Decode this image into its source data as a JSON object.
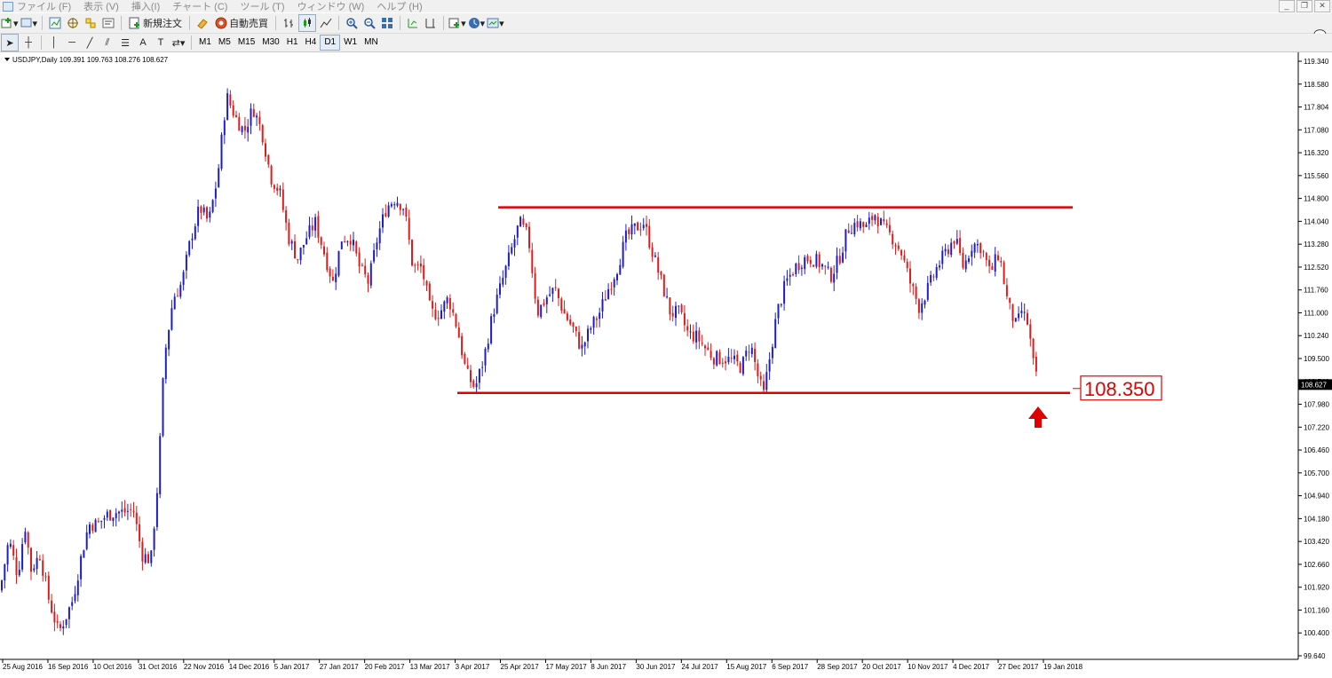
{
  "menu": {
    "items": [
      "ファイル (F)",
      "表示 (V)",
      "挿入(I)",
      "チャート (C)",
      "ツール (T)",
      "ウィンドウ (W)",
      "ヘルプ (H)"
    ]
  },
  "toolbar": {
    "new_order_label": "新規注文",
    "auto_trade_label": "自動売買",
    "timeframes": [
      "M1",
      "M5",
      "M15",
      "M30",
      "H1",
      "H4",
      "D1",
      "W1",
      "MN"
    ],
    "active_timeframe": "D1"
  },
  "chart_header": {
    "symbol_info": "USDJPY,Daily  109.391 109.763 108.276 108.627"
  },
  "colors": {
    "bull": "#1e1ec8",
    "bear": "#e01b1b",
    "level_line": "#e00000",
    "arrow": "#e00000"
  },
  "chart_data": {
    "type": "candlestick",
    "symbol": "USDJPY",
    "timeframe": "Daily",
    "ohlc_last": {
      "open": 109.391,
      "high": 109.763,
      "low": 108.276,
      "close": 108.627
    },
    "current_price_label": "108.627",
    "y_ticks": [
      "119.340",
      "118.580",
      "117.804",
      "117.080",
      "116.320",
      "115.560",
      "114.800",
      "114.040",
      "113.280",
      "112.520",
      "111.760",
      "111.000",
      "110.240",
      "109.500",
      "108.740",
      "107.980",
      "107.220",
      "106.460",
      "105.700",
      "104.940",
      "104.180",
      "103.420",
      "102.660",
      "101.920",
      "101.160",
      "100.400",
      "99.640"
    ],
    "x_ticks": [
      "25 Aug 2016",
      "16 Sep 2016",
      "10 Oct 2016",
      "31 Oct 2016",
      "22 Nov 2016",
      "14 Dec 2016",
      "5 Jan 2017",
      "27 Jan 2017",
      "20 Feb 2017",
      "13 Mar 2017",
      "3 Apr 2017",
      "25 Apr 2017",
      "17 May 2017",
      "8 Jun 2017",
      "30 Jun 2017",
      "24 Jul 2017",
      "15 Aug 2017",
      "6 Sep 2017",
      "28 Sep 2017",
      "20 Oct 2017",
      "10 Nov 2017",
      "4 Dec 2017",
      "27 Dec 2017",
      "19 Jan 2018"
    ],
    "ylim": [
      99.64,
      119.34
    ],
    "resistance_level": 114.5,
    "support_level": 108.35,
    "support_label": "108.350",
    "price_path": [
      [
        0,
        101.8
      ],
      [
        10,
        103.5
      ],
      [
        20,
        102.3
      ],
      [
        28,
        104.0
      ],
      [
        35,
        102.5
      ],
      [
        45,
        103.0
      ],
      [
        55,
        101.5
      ],
      [
        66,
        100.4
      ],
      [
        75,
        101.0
      ],
      [
        82,
        101.5
      ],
      [
        92,
        103.0
      ],
      [
        100,
        104.0
      ],
      [
        110,
        104.0
      ],
      [
        120,
        104.3
      ],
      [
        130,
        104.4
      ],
      [
        140,
        104.4
      ],
      [
        150,
        104.5
      ],
      [
        160,
        103.0
      ],
      [
        170,
        102.8
      ],
      [
        178,
        105.5
      ],
      [
        185,
        109.5
      ],
      [
        195,
        111.5
      ],
      [
        205,
        112.0
      ],
      [
        215,
        113.5
      ],
      [
        225,
        114.5
      ],
      [
        235,
        114.0
      ],
      [
        245,
        115.5
      ],
      [
        255,
        118.2
      ],
      [
        265,
        117.5
      ],
      [
        275,
        117.0
      ],
      [
        285,
        117.8
      ],
      [
        295,
        117.0
      ],
      [
        305,
        115.5
      ],
      [
        315,
        115.0
      ],
      [
        325,
        113.5
      ],
      [
        335,
        112.8
      ],
      [
        345,
        113.5
      ],
      [
        355,
        114.0
      ],
      [
        365,
        113.0
      ],
      [
        375,
        112.0
      ],
      [
        385,
        113.5
      ],
      [
        395,
        113.5
      ],
      [
        405,
        112.5
      ],
      [
        415,
        112.0
      ],
      [
        425,
        113.5
      ],
      [
        435,
        114.5
      ],
      [
        445,
        114.8
      ],
      [
        455,
        114.5
      ],
      [
        465,
        112.5
      ],
      [
        475,
        112.5
      ],
      [
        485,
        111.0
      ],
      [
        495,
        111.0
      ],
      [
        505,
        111.5
      ],
      [
        515,
        110.5
      ],
      [
        525,
        109.0
      ],
      [
        535,
        108.5
      ],
      [
        545,
        109.5
      ],
      [
        555,
        111.0
      ],
      [
        565,
        112.0
      ],
      [
        575,
        113.0
      ],
      [
        585,
        114.0
      ],
      [
        595,
        113.5
      ],
      [
        605,
        111.0
      ],
      [
        615,
        111.5
      ],
      [
        625,
        111.8
      ],
      [
        635,
        111.0
      ],
      [
        645,
        110.5
      ],
      [
        655,
        109.8
      ],
      [
        665,
        110.5
      ],
      [
        675,
        111.0
      ],
      [
        685,
        111.8
      ],
      [
        695,
        112.5
      ],
      [
        705,
        113.5
      ],
      [
        715,
        113.8
      ],
      [
        725,
        114.0
      ],
      [
        735,
        113.0
      ],
      [
        745,
        112.0
      ],
      [
        755,
        111.0
      ],
      [
        765,
        111.0
      ],
      [
        775,
        110.3
      ],
      [
        785,
        110.2
      ],
      [
        795,
        109.8
      ],
      [
        805,
        109.5
      ],
      [
        815,
        109.5
      ],
      [
        825,
        109.4
      ],
      [
        835,
        109.2
      ],
      [
        845,
        110.0
      ],
      [
        855,
        108.7
      ],
      [
        860,
        108.3
      ],
      [
        865,
        109.2
      ],
      [
        875,
        111.0
      ],
      [
        885,
        112.0
      ],
      [
        895,
        112.5
      ],
      [
        905,
        112.8
      ],
      [
        915,
        112.8
      ],
      [
        925,
        112.6
      ],
      [
        935,
        112.2
      ],
      [
        945,
        112.8
      ],
      [
        955,
        113.8
      ],
      [
        965,
        114.0
      ],
      [
        975,
        113.8
      ],
      [
        985,
        114.3
      ],
      [
        995,
        113.8
      ],
      [
        1005,
        113.5
      ],
      [
        1015,
        113.0
      ],
      [
        1025,
        112.0
      ],
      [
        1035,
        111.2
      ],
      [
        1045,
        111.8
      ],
      [
        1055,
        112.5
      ],
      [
        1065,
        113.0
      ],
      [
        1075,
        113.5
      ],
      [
        1085,
        112.5
      ],
      [
        1095,
        113.3
      ],
      [
        1105,
        113.2
      ],
      [
        1115,
        112.3
      ],
      [
        1125,
        113.0
      ],
      [
        1135,
        111.3
      ],
      [
        1145,
        110.5
      ],
      [
        1150,
        111.1
      ],
      [
        1158,
        110.6
      ],
      [
        1163,
        109.4
      ],
      [
        1168,
        108.7
      ]
    ]
  }
}
